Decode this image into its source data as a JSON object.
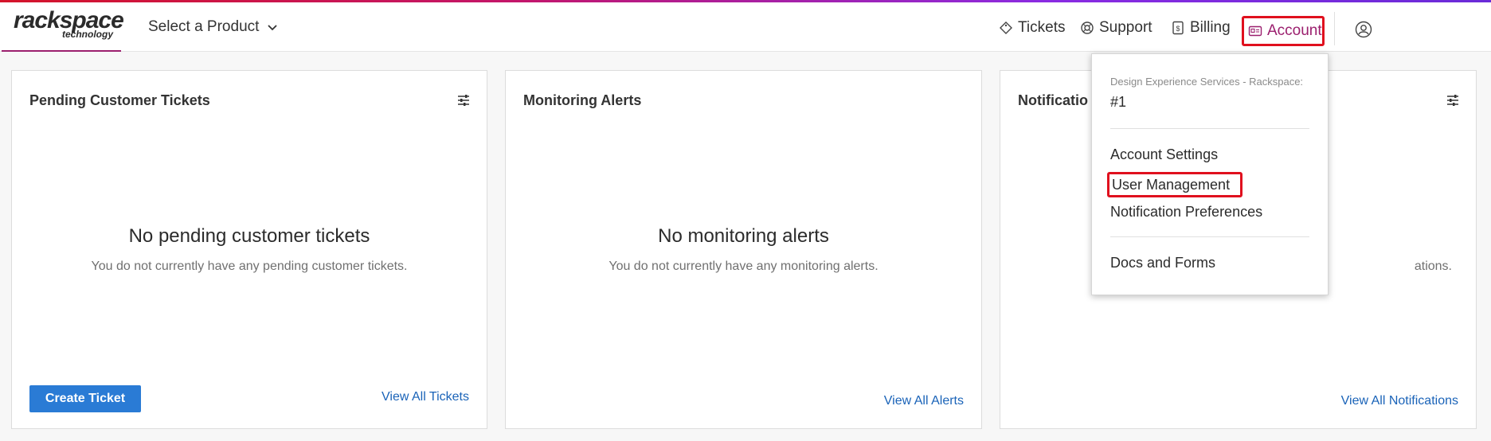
{
  "header": {
    "logo_main": "rackspace",
    "logo_sub": "technology",
    "product_select": "Select a Product",
    "nav": {
      "tickets": "Tickets",
      "support": "Support",
      "billing": "Billing",
      "account": "Account"
    }
  },
  "cards": [
    {
      "title": "Pending Customer Tickets",
      "empty_title": "No pending customer tickets",
      "empty_sub": "You do not currently have any pending customer tickets.",
      "button": "Create Ticket",
      "link": "View All Tickets"
    },
    {
      "title": "Monitoring Alerts",
      "empty_title": "No monitoring alerts",
      "empty_sub": "You do not currently have any monitoring alerts.",
      "link": "View All Alerts"
    },
    {
      "title": "Notificatio",
      "empty_sub_tail": "ations.",
      "link": "View All Notifications"
    }
  ],
  "account_menu": {
    "account_label": "Design Experience Services - Rackspace:",
    "account_number": "#1",
    "items": [
      "Account Settings",
      "User Management",
      "Notification Preferences",
      "Docs and Forms"
    ]
  },
  "colors": {
    "brand": "#9b1f6e",
    "link": "#1a63b8",
    "button": "#2a7bd5",
    "highlight": "#e0101e"
  }
}
